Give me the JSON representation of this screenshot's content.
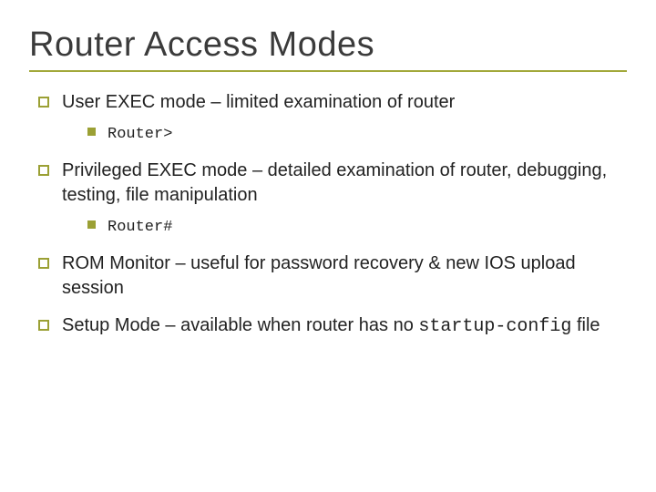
{
  "title": "Router Access Modes",
  "items": [
    {
      "text": "User EXEC mode – limited examination of router",
      "sub": [
        {
          "text": "Router>",
          "mono": true
        }
      ]
    },
    {
      "text": "Privileged EXEC mode – detailed examination of router, debugging, testing, file manipulation",
      "sub": [
        {
          "text": "Router#",
          "mono": true
        }
      ]
    },
    {
      "text": "ROM Monitor – useful for password recovery & new IOS upload session",
      "sub": []
    },
    {
      "text_prefix": "Setup Mode – available when router has no ",
      "mono_part": "startup-config",
      "text_suffix": " file",
      "sub": []
    }
  ]
}
